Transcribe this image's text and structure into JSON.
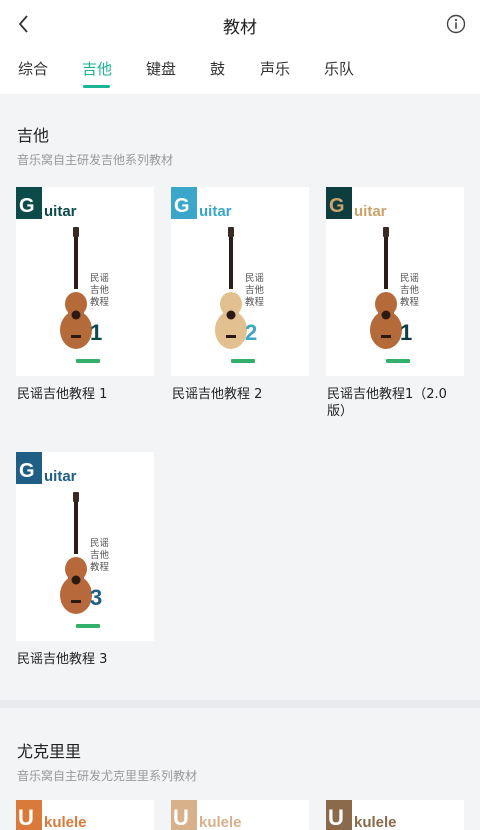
{
  "header": {
    "title": "教材",
    "back_icon": "chevron-left-icon",
    "info_icon": "info-circle-icon"
  },
  "tabs": [
    {
      "label": "综合",
      "active": false
    },
    {
      "label": "吉他",
      "active": true
    },
    {
      "label": "键盘",
      "active": false
    },
    {
      "label": "鼓",
      "active": false
    },
    {
      "label": "声乐",
      "active": false
    },
    {
      "label": "乐队",
      "active": false
    }
  ],
  "colors": {
    "accent": "#1ab394",
    "book1": "#0d4a4a",
    "book2": "#3aa6c9",
    "book3_box": "#0d3d3f",
    "book3_text": "#c9a36a",
    "book4": "#1f5f86",
    "uke1": "#d97a3a",
    "uke2": "#d8b08a",
    "uke3": "#8a6a4a"
  },
  "guitar_section": {
    "title": "吉他",
    "subtitle": "音乐窝自主研发吉他系列教材",
    "books": [
      {
        "title": "民谣吉他教程 1",
        "cover_logo_initial": "G",
        "cover_logo_rest": "uitar",
        "cover_text": "民谣吉他教程",
        "cover_number": "1",
        "color": "#0d4a4a"
      },
      {
        "title": "民谣吉他教程 2",
        "cover_logo_initial": "G",
        "cover_logo_rest": "uitar",
        "cover_text": "民谣吉他教程",
        "cover_number": "2",
        "color": "#3aa6c9"
      },
      {
        "title": "民谣吉他教程1（2.0版）",
        "cover_logo_initial": "G",
        "cover_logo_rest": "uitar",
        "cover_text": "民谣吉他教程",
        "cover_number": "1",
        "color": "#0d3d3f"
      },
      {
        "title": "民谣吉他教程 3",
        "cover_logo_initial": "G",
        "cover_logo_rest": "uitar",
        "cover_text": "民谣吉他教程",
        "cover_number": "3",
        "color": "#1f5f86"
      }
    ]
  },
  "ukulele_section": {
    "title": "尤克里里",
    "subtitle": "音乐窝自主研发尤克里里系列教材",
    "books": [
      {
        "cover_logo_initial": "U",
        "cover_logo_rest": "kulele",
        "color": "#d97a3a"
      },
      {
        "cover_logo_initial": "U",
        "cover_logo_rest": "kulele",
        "color": "#d8b08a"
      },
      {
        "cover_logo_initial": "U",
        "cover_logo_rest": "kulele",
        "color": "#8a6a4a"
      }
    ]
  }
}
